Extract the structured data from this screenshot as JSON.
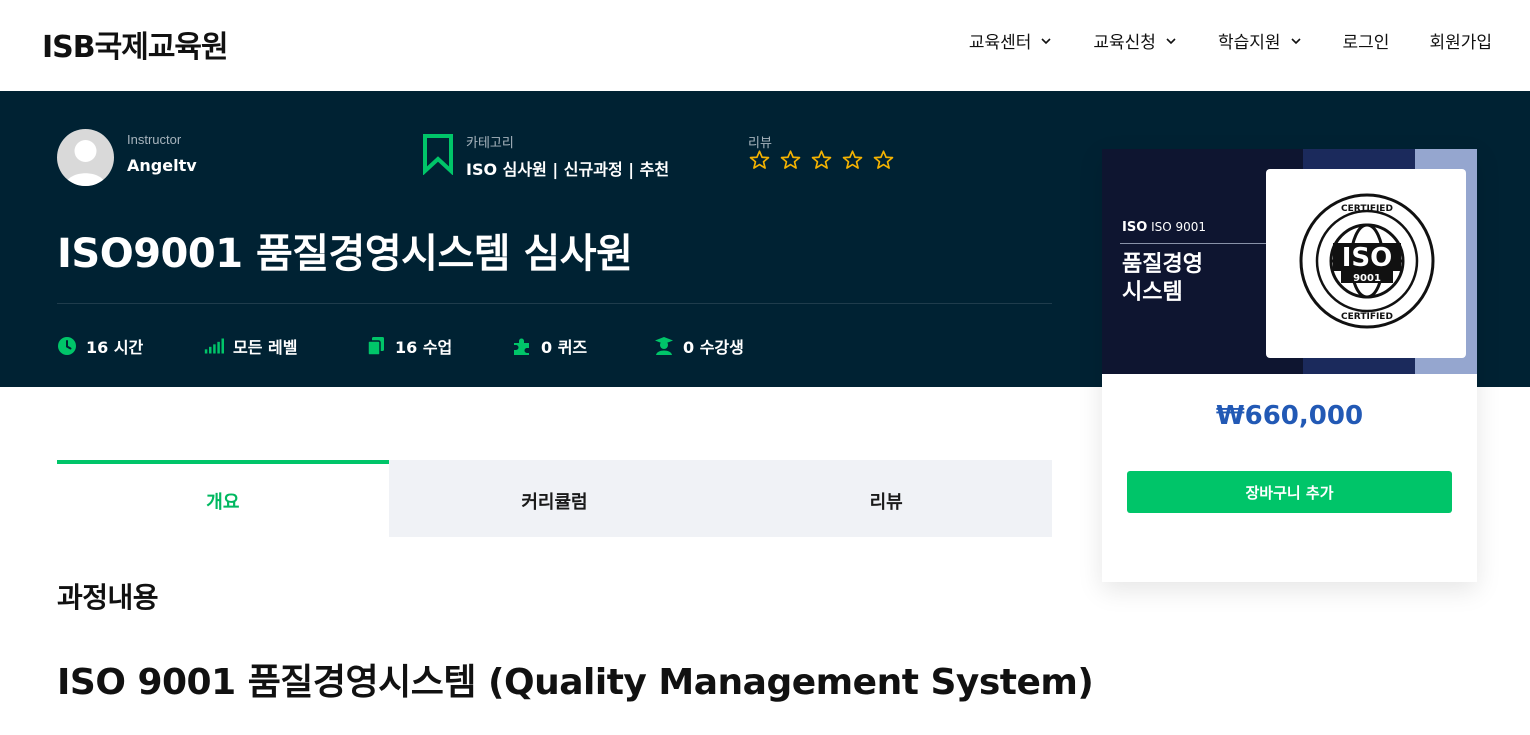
{
  "header": {
    "logo": "ISB국제교육원",
    "nav": [
      {
        "label": "교육센터",
        "has_dropdown": true
      },
      {
        "label": "교육신청",
        "has_dropdown": true
      },
      {
        "label": "학습지원",
        "has_dropdown": true
      },
      {
        "label": "로그인",
        "has_dropdown": false
      },
      {
        "label": "회원가입",
        "has_dropdown": false
      }
    ]
  },
  "hero": {
    "instructor_label": "Instructor",
    "instructor_name": "Angeltv",
    "category_label": "카테고리",
    "category_value": "ISO 심사원 | 신규과정 | 추천",
    "review_label": "리뷰",
    "rating_stars": 0,
    "rating_max": 5,
    "title": "ISO9001 품질경영시스템 심사원",
    "stats": [
      {
        "icon": "clock-icon",
        "label": "16 시간"
      },
      {
        "icon": "level-bars-icon",
        "label": "모든 레벨"
      },
      {
        "icon": "documents-icon",
        "label": "16 수업"
      },
      {
        "icon": "puzzle-icon",
        "label": "0 퀴즈"
      },
      {
        "icon": "student-icon",
        "label": "0 수강생"
      }
    ]
  },
  "card": {
    "thumb_iso_badge": "ISO",
    "thumb_iso_code": "ISO 9001",
    "thumb_title": "품질경영\n시스템",
    "seal_text": "CERTIFIED",
    "seal_iso": "ISO",
    "seal_num": "9001",
    "price": "₩660,000",
    "cart_button": "장바구니 추가"
  },
  "tabs": [
    {
      "label": "개요",
      "active": true
    },
    {
      "label": "커리큘럼",
      "active": false
    },
    {
      "label": "리뷰",
      "active": false
    }
  ],
  "content": {
    "section_heading": "과정내용",
    "title": "ISO 9001 품질경영시스템 (Quality Management System)"
  },
  "colors": {
    "hero_bg": "#002233",
    "accent_green": "#00c569",
    "price_blue": "#2259b5",
    "star_yellow": "#f5b301"
  }
}
